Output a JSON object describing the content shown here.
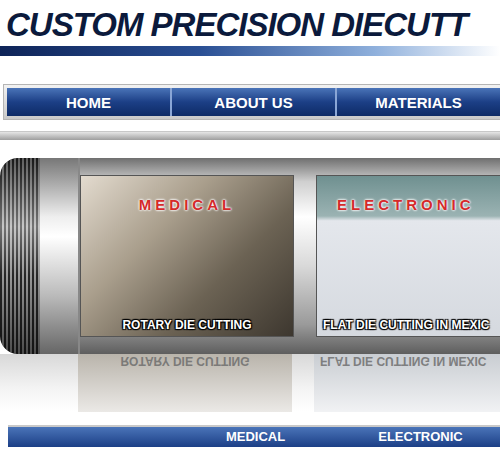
{
  "header": {
    "title": "CUSTOM PRECISION DIECUTT"
  },
  "nav": [
    {
      "label": "HOME",
      "selected": false
    },
    {
      "label": "ABOUT US",
      "selected": false
    },
    {
      "label": "MATERIALS",
      "selected": false
    }
  ],
  "banner": {
    "panels": [
      {
        "title": "MEDICAL",
        "caption": "ROTARY DIE CUTTING"
      },
      {
        "title": "ELECTRONIC",
        "caption": "FLAT DIE CUTTING IN MEXIC"
      }
    ]
  },
  "footer_nav": [
    {
      "label": "MEDICAL",
      "selected": false
    },
    {
      "label": "ELECTRONIC",
      "selected": false
    }
  ]
}
